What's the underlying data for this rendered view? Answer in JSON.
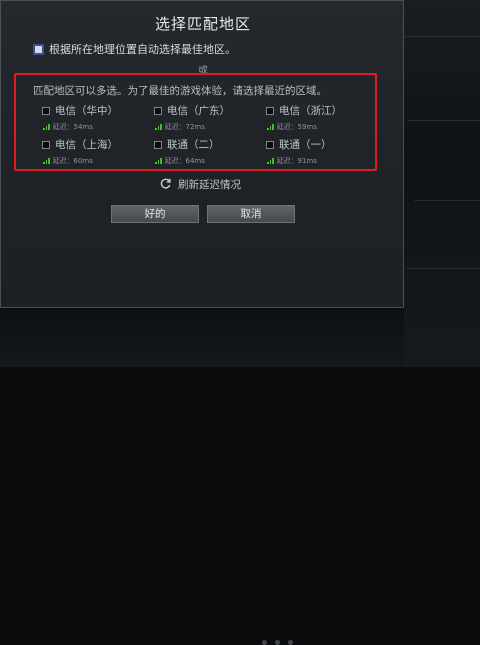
{
  "dialog": {
    "title": "选择匹配地区",
    "auto_select_label": "根据所在地理位置自动选择最佳地区。",
    "auto_select_checked": true,
    "or_text": "或",
    "region_description": "匹配地区可以多选。为了最佳的游戏体验，请选择最近的区域。",
    "ping_prefix": "延迟：",
    "regions": [
      {
        "name": "电信（华中）",
        "ping": "54ms",
        "checked": false
      },
      {
        "name": "电信（广东）",
        "ping": "72ms",
        "checked": false
      },
      {
        "name": "电信（浙江）",
        "ping": "59ms",
        "checked": false
      },
      {
        "name": "电信（上海）",
        "ping": "60ms",
        "checked": false
      },
      {
        "name": "联通（二）",
        "ping": "64ms",
        "checked": false
      },
      {
        "name": "联通（一）",
        "ping": "91ms",
        "checked": false
      }
    ],
    "refresh_label": "刷新延迟情况",
    "ok_button": "好的",
    "cancel_button": "取消"
  },
  "colors": {
    "highlight_border": "#e01c23",
    "signal": "#43c02a",
    "dialog_bg": "#23272b"
  },
  "icons": {
    "refresh": "refresh-icon",
    "signal": "signal-strength-icon",
    "checkbox": "checkbox-icon"
  }
}
